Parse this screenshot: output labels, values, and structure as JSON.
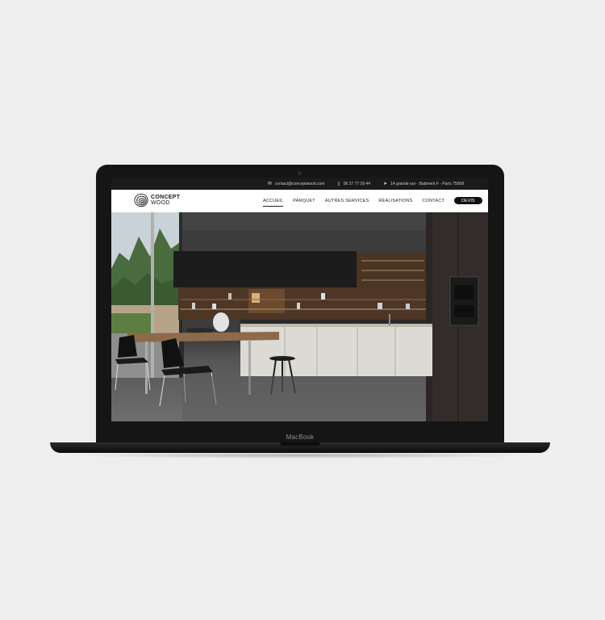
{
  "topbar": {
    "email": "contact@conceptwood.com",
    "phone": "06 27 77 29 44",
    "address": "14 grande rue - Batiment F - Paris 75008"
  },
  "logo": {
    "line1": "CONCEPT",
    "line2": "WOOD"
  },
  "nav": {
    "items": [
      "ACCUEIL",
      "PARQUET",
      "AUTRES SERVICES",
      "RÉALISATIONS",
      "CONTACT"
    ],
    "active": "ACCUEIL",
    "cta": "DEVIS"
  },
  "device": {
    "label": "MacBook"
  },
  "icons": [
    "envelope-icon",
    "phone-icon",
    "location-arrow-icon",
    "search-icon"
  ]
}
